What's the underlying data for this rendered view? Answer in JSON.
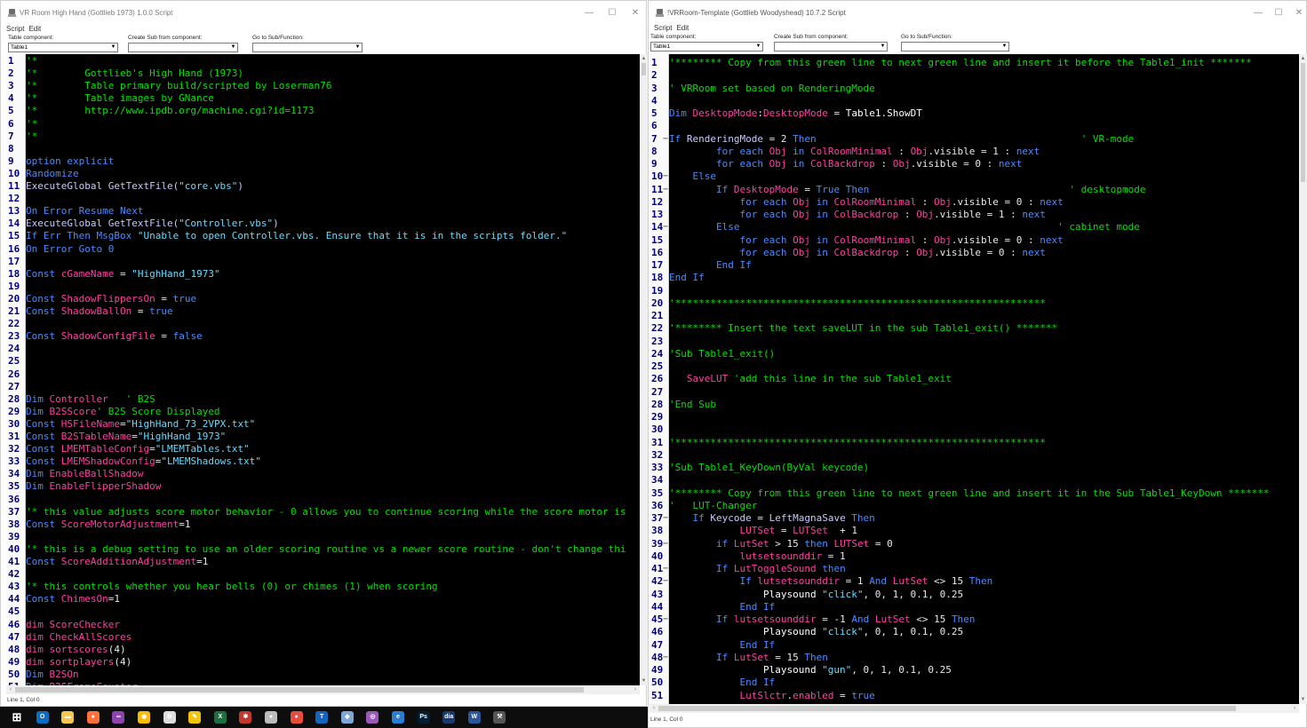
{
  "left_window": {
    "title": "VR Room High Hand (Gottlieb 1973) 1.0.0 Script",
    "menu": [
      "Script",
      "Edit"
    ],
    "labels": {
      "table_component": "Table component:",
      "create_sub": "Create Sub from component:",
      "goto_sub": "Go to Sub/Function:"
    },
    "table_component_value": "Table1",
    "create_sub_value": "",
    "goto_sub_value": "",
    "status": "Line 1, Col 0",
    "code": [
      [
        [
          "cm",
          "'*"
        ]
      ],
      [
        [
          "cm",
          "'*        Gottlieb's High Hand (1973)"
        ]
      ],
      [
        [
          "cm",
          "'*        Table primary build/scripted by Loserman76"
        ]
      ],
      [
        [
          "cm",
          "'*        Table images by GNance"
        ]
      ],
      [
        [
          "cm",
          "'*        http://www.ipdb.org/machine.cgi?id=1173"
        ]
      ],
      [
        [
          "cm",
          "'*"
        ]
      ],
      [
        [
          "cm",
          "'*"
        ]
      ],
      [],
      [
        [
          "kw",
          "option explicit"
        ]
      ],
      [
        [
          "kw",
          "Randomize"
        ]
      ],
      [
        [
          "fn",
          "ExecuteGlobal GetTextFile("
        ],
        [
          "st",
          "\"core.vbs\""
        ],
        [
          "fn",
          ")"
        ]
      ],
      [],
      [
        [
          "kw",
          "On Error Resume Next"
        ]
      ],
      [
        [
          "fn",
          "ExecuteGlobal GetTextFile("
        ],
        [
          "st",
          "\"Controller.vbs\""
        ],
        [
          "fn",
          ")"
        ]
      ],
      [
        [
          "kw",
          "If Err Then MsgBox "
        ],
        [
          "st",
          "\"Unable to open Controller.vbs. Ensure that it is in the scripts folder.\""
        ]
      ],
      [
        [
          "kw",
          "On Error Goto 0"
        ]
      ],
      [],
      [
        [
          "kw",
          "Const "
        ],
        [
          "id",
          "cGameName"
        ],
        [
          "op",
          " = "
        ],
        [
          "st",
          "\"HighHand_1973\""
        ]
      ],
      [],
      [
        [
          "kw",
          "Const "
        ],
        [
          "id",
          "ShadowFlippersOn"
        ],
        [
          "op",
          " = "
        ],
        [
          "kw",
          "true"
        ]
      ],
      [
        [
          "kw",
          "Const "
        ],
        [
          "id",
          "ShadowBallOn"
        ],
        [
          "op",
          " = "
        ],
        [
          "kw",
          "true"
        ]
      ],
      [],
      [
        [
          "kw",
          "Const "
        ],
        [
          "id",
          "ShadowConfigFile"
        ],
        [
          "op",
          " = "
        ],
        [
          "kw",
          "false"
        ]
      ],
      [],
      [],
      [],
      [],
      [
        [
          "kw",
          "Dim "
        ],
        [
          "id",
          "Controller"
        ],
        [
          "cm",
          "   ' B2S"
        ]
      ],
      [
        [
          "kw",
          "Dim "
        ],
        [
          "id",
          "B2SScore"
        ],
        [
          "cm",
          "' B2S Score Displayed"
        ]
      ],
      [
        [
          "kw",
          "Const "
        ],
        [
          "id",
          "HSFileName"
        ],
        [
          "op",
          "="
        ],
        [
          "st",
          "\"HighHand_73_2VPX.txt\""
        ]
      ],
      [
        [
          "kw",
          "Const "
        ],
        [
          "id",
          "B2STableName"
        ],
        [
          "op",
          "="
        ],
        [
          "st",
          "\"HighHand_1973\""
        ]
      ],
      [
        [
          "kw",
          "Const "
        ],
        [
          "id",
          "LMEMTableConfig"
        ],
        [
          "op",
          "="
        ],
        [
          "st",
          "\"LMEMTables.txt\""
        ]
      ],
      [
        [
          "kw",
          "Const "
        ],
        [
          "id",
          "LMEMShadowConfig"
        ],
        [
          "op",
          "="
        ],
        [
          "st",
          "\"LMEMShadows.txt\""
        ]
      ],
      [
        [
          "kw",
          "Dim "
        ],
        [
          "id",
          "EnableBallShadow"
        ]
      ],
      [
        [
          "kw",
          "Dim "
        ],
        [
          "id",
          "EnableFlipperShadow"
        ]
      ],
      [],
      [
        [
          "cm",
          "'* this value adjusts score motor behavior - 0 allows you to continue scoring while the score motor is"
        ]
      ],
      [
        [
          "kw",
          "Const "
        ],
        [
          "id",
          "ScoreMotorAdjustment"
        ],
        [
          "op",
          "=1"
        ]
      ],
      [],
      [
        [
          "cm",
          "'* this is a debug setting to use an older scoring routine vs a newer score routine - don't change thi"
        ]
      ],
      [
        [
          "kw",
          "Const "
        ],
        [
          "id",
          "ScoreAdditionAdjustment"
        ],
        [
          "op",
          "=1"
        ]
      ],
      [],
      [
        [
          "cm",
          "'* this controls whether you hear bells (0) or chimes (1) when scoring"
        ]
      ],
      [
        [
          "kw",
          "Const "
        ],
        [
          "id",
          "ChimesOn"
        ],
        [
          "op",
          "=1"
        ]
      ],
      [],
      [
        [
          "id",
          "dim ScoreChecker"
        ]
      ],
      [
        [
          "id",
          "dim CheckAllScores"
        ]
      ],
      [
        [
          "id",
          "dim sortscores"
        ],
        [
          "op",
          "(4)"
        ]
      ],
      [
        [
          "id",
          "dim sortplayers"
        ],
        [
          "op",
          "(4)"
        ]
      ],
      [
        [
          "kw",
          "Dim "
        ],
        [
          "id",
          "B2SOn"
        ]
      ],
      [
        [
          "kw",
          "Dim "
        ],
        [
          "id",
          "B2SFrameCounter"
        ]
      ]
    ]
  },
  "right_window": {
    "title": "!VRRoom-Template (Gottlieb Woodyshead) 10.7.2 Script",
    "menu": [
      "Script",
      "Edit"
    ],
    "labels": {
      "table_component": "Table component:",
      "create_sub": "Create Sub from component:",
      "goto_sub": "Go to Sub/Function:"
    },
    "table_component_value": "Table1",
    "create_sub_value": "",
    "goto_sub_value": "",
    "status": "Line 1, Col 0",
    "code": [
      [
        [
          "cm",
          "'******** Copy from this green line to next green line and insert it before the Table1_init *******"
        ]
      ],
      [],
      [
        [
          "cm",
          "' VRRoom set based on RenderingMode"
        ]
      ],
      [],
      [
        [
          "kw",
          "Dim "
        ],
        [
          "id",
          "DesktopMode"
        ],
        [
          "op",
          ":"
        ],
        [
          "id",
          "DesktopMode"
        ],
        [
          "op",
          " = "
        ],
        [
          "df",
          "Table1.ShowDT"
        ]
      ],
      [],
      [
        [
          "kw",
          "If "
        ],
        [
          "fn",
          "RenderingMode"
        ],
        [
          "op",
          " = 2 "
        ],
        [
          "kw",
          "Then"
        ],
        [
          "cm",
          "                                             ' VR-mode"
        ]
      ],
      [
        [
          "kw",
          "        for each "
        ],
        [
          "id",
          "Obj"
        ],
        [
          "kw",
          " in "
        ],
        [
          "id",
          "ColRoomMinimal"
        ],
        [
          "op",
          " : "
        ],
        [
          "id",
          "Obj"
        ],
        [
          "op",
          ".visible = 1 : "
        ],
        [
          "kw",
          "next"
        ]
      ],
      [
        [
          "kw",
          "        for each "
        ],
        [
          "id",
          "Obj"
        ],
        [
          "kw",
          " in "
        ],
        [
          "id",
          "ColBackdrop"
        ],
        [
          "op",
          " : "
        ],
        [
          "id",
          "Obj"
        ],
        [
          "op",
          ".visible = 0 : "
        ],
        [
          "kw",
          "next"
        ]
      ],
      [
        [
          "kw",
          "    Else"
        ]
      ],
      [
        [
          "kw",
          "        If "
        ],
        [
          "id",
          "DesktopMode"
        ],
        [
          "op",
          " = "
        ],
        [
          "kw",
          "True Then"
        ],
        [
          "cm",
          "                                  ' desktopmode"
        ]
      ],
      [
        [
          "kw",
          "            for each "
        ],
        [
          "id",
          "Obj"
        ],
        [
          "kw",
          " in "
        ],
        [
          "id",
          "ColRoomMinimal"
        ],
        [
          "op",
          " : "
        ],
        [
          "id",
          "Obj"
        ],
        [
          "op",
          ".visible = 0 : "
        ],
        [
          "kw",
          "next"
        ]
      ],
      [
        [
          "kw",
          "            for each "
        ],
        [
          "id",
          "Obj"
        ],
        [
          "kw",
          " in "
        ],
        [
          "id",
          "ColBackdrop"
        ],
        [
          "op",
          " : "
        ],
        [
          "id",
          "Obj"
        ],
        [
          "op",
          ".visible = 1 : "
        ],
        [
          "kw",
          "next"
        ]
      ],
      [
        [
          "kw",
          "        Else"
        ],
        [
          "cm",
          "                                                      ' cabinet mode"
        ]
      ],
      [
        [
          "kw",
          "            for each "
        ],
        [
          "id",
          "Obj"
        ],
        [
          "kw",
          " in "
        ],
        [
          "id",
          "ColRoomMinimal"
        ],
        [
          "op",
          " : "
        ],
        [
          "id",
          "Obj"
        ],
        [
          "op",
          ".visible = 0 : "
        ],
        [
          "kw",
          "next"
        ]
      ],
      [
        [
          "kw",
          "            for each "
        ],
        [
          "id",
          "Obj"
        ],
        [
          "kw",
          " in "
        ],
        [
          "id",
          "ColBackdrop"
        ],
        [
          "op",
          " : "
        ],
        [
          "id",
          "Obj"
        ],
        [
          "op",
          ".visible = 0 : "
        ],
        [
          "kw",
          "next"
        ]
      ],
      [
        [
          "kw",
          "        End If"
        ]
      ],
      [
        [
          "kw",
          "End If"
        ]
      ],
      [],
      [
        [
          "cm",
          "'***************************************************************"
        ]
      ],
      [],
      [
        [
          "cm",
          "'******** Insert the text saveLUT in the sub Table1_exit() *******"
        ]
      ],
      [],
      [
        [
          "cm",
          "'Sub Table1_exit()"
        ]
      ],
      [],
      [
        [
          "id",
          "   SaveLUT"
        ],
        [
          "cm",
          " 'add this line in the sub Table1_exit"
        ]
      ],
      [],
      [
        [
          "cm",
          "'End Sub"
        ]
      ],
      [],
      [],
      [
        [
          "cm",
          "'***************************************************************"
        ]
      ],
      [],
      [
        [
          "cm",
          "'Sub Table1_KeyDown(ByVal keycode)"
        ]
      ],
      [],
      [
        [
          "cm",
          "'******** Copy from this green line to next green line and insert it in the Sub Table1_KeyDown *******"
        ]
      ],
      [
        [
          "cm",
          "'   LUT-Changer"
        ]
      ],
      [
        [
          "kw",
          "    If "
        ],
        [
          "fn",
          "Keycode"
        ],
        [
          "op",
          " = "
        ],
        [
          "fn",
          "LeftMagnaSave"
        ],
        [
          "kw",
          " Then"
        ]
      ],
      [
        [
          "id",
          "            LUTSet"
        ],
        [
          "op",
          " = "
        ],
        [
          "id",
          "LUTSet"
        ],
        [
          "op",
          "  + 1"
        ]
      ],
      [
        [
          "kw",
          "        if "
        ],
        [
          "id",
          "LutSet"
        ],
        [
          "op",
          " > 15 "
        ],
        [
          "kw",
          "then "
        ],
        [
          "id",
          "LUTSet"
        ],
        [
          "op",
          " = 0"
        ]
      ],
      [
        [
          "id",
          "            lutsetsounddir"
        ],
        [
          "op",
          " = 1"
        ]
      ],
      [
        [
          "kw",
          "        If "
        ],
        [
          "id",
          "LutToggleSound"
        ],
        [
          "kw",
          " then"
        ]
      ],
      [
        [
          "kw",
          "            If "
        ],
        [
          "id",
          "lutsetsounddir"
        ],
        [
          "op",
          " = 1 "
        ],
        [
          "kw",
          "And "
        ],
        [
          "id",
          "LutSet"
        ],
        [
          "op",
          " <> 15 "
        ],
        [
          "kw",
          "Then"
        ]
      ],
      [
        [
          "df",
          "                Playsound "
        ],
        [
          "st",
          "\"click\""
        ],
        [
          "op",
          ", 0, 1, 0.1, 0.25"
        ]
      ],
      [
        [
          "kw",
          "            End If"
        ]
      ],
      [
        [
          "kw",
          "        If "
        ],
        [
          "id",
          "lutsetsounddir"
        ],
        [
          "op",
          " = -1 "
        ],
        [
          "kw",
          "And "
        ],
        [
          "id",
          "LutSet"
        ],
        [
          "op",
          " <> 15 "
        ],
        [
          "kw",
          "Then"
        ]
      ],
      [
        [
          "df",
          "                Playsound "
        ],
        [
          "st",
          "\"click\""
        ],
        [
          "op",
          ", 0, 1, 0.1, 0.25"
        ]
      ],
      [
        [
          "kw",
          "            End If"
        ]
      ],
      [
        [
          "kw",
          "        If "
        ],
        [
          "id",
          "LutSet"
        ],
        [
          "op",
          " = 15 "
        ],
        [
          "kw",
          "Then"
        ]
      ],
      [
        [
          "df",
          "                Playsound "
        ],
        [
          "st",
          "\"gun\""
        ],
        [
          "op",
          ", 0, 1, 0.1, 0.25"
        ]
      ],
      [
        [
          "kw",
          "            End If"
        ]
      ],
      [
        [
          "id",
          "            LutSlctr"
        ],
        [
          "op",
          "."
        ],
        [
          "id",
          "enabled"
        ],
        [
          "op",
          " = "
        ],
        [
          "kw",
          "true"
        ]
      ]
    ],
    "fold_lines": [
      7,
      10,
      11,
      14,
      37,
      39,
      41,
      42,
      45,
      48
    ]
  },
  "taskbar": {
    "icons": [
      {
        "name": "windows-start-icon",
        "glyph": "⊞",
        "color": "#ffffff"
      },
      {
        "name": "outlook-icon",
        "glyph": "O",
        "color": "#0f6cbd"
      },
      {
        "name": "file-explorer-icon",
        "glyph": "▬",
        "color": "#f2c94c"
      },
      {
        "name": "firefox-icon",
        "glyph": "●",
        "color": "#ff7139"
      },
      {
        "name": "app-purple-icon",
        "glyph": "∞",
        "color": "#8e44ad"
      },
      {
        "name": "chrome-icon",
        "glyph": "◉",
        "color": "#fbbc05"
      },
      {
        "name": "settings-cog-icon",
        "glyph": "⚙",
        "color": "#dddddd"
      },
      {
        "name": "paint-icon",
        "glyph": "✎",
        "color": "#f1c40f"
      },
      {
        "name": "excel-icon",
        "glyph": "X",
        "color": "#1d6f42"
      },
      {
        "name": "red-app-icon",
        "glyph": "✱",
        "color": "#c0392b"
      },
      {
        "name": "round-app-icon",
        "glyph": "●",
        "color": "#bbbbbb"
      },
      {
        "name": "red-circle-app-icon",
        "glyph": "●",
        "color": "#e74c3c"
      },
      {
        "name": "blue-app-icon",
        "glyph": "T",
        "color": "#1565c0"
      },
      {
        "name": "vpx-icon",
        "glyph": "◆",
        "color": "#7fa6d9"
      },
      {
        "name": "visual-pinball-icon",
        "glyph": "◎",
        "color": "#9b59b6"
      },
      {
        "name": "edge-icon",
        "glyph": "e",
        "color": "#2b7cd3"
      },
      {
        "name": "photoshop-icon",
        "glyph": "Ps",
        "color": "#001e36"
      },
      {
        "name": "dia-icon",
        "glyph": "dia",
        "color": "#1b3a6b"
      },
      {
        "name": "word-icon",
        "glyph": "W",
        "color": "#2b579a"
      },
      {
        "name": "tool-icon",
        "glyph": "⚒",
        "color": "#555555"
      }
    ]
  }
}
